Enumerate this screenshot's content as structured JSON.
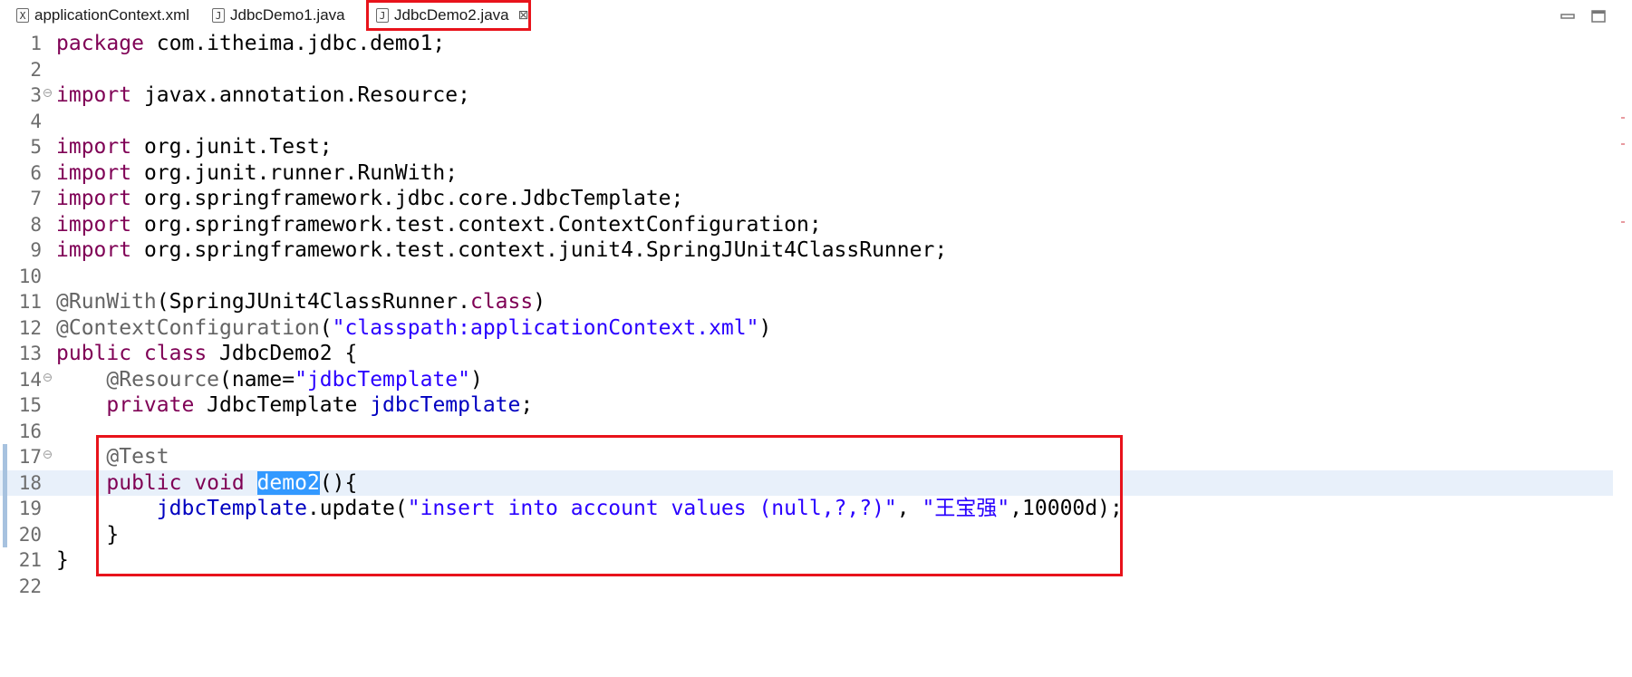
{
  "tabs": [
    {
      "label": "applicationContext.xml",
      "icon": "xml-file-icon",
      "glyph": "X"
    },
    {
      "label": "JdbcDemo1.java",
      "icon": "java-file-icon",
      "glyph": "J"
    },
    {
      "label": "JdbcDemo2.java",
      "icon": "java-file-icon",
      "glyph": "J",
      "close": "⊠",
      "active": true
    }
  ],
  "window_controls": {
    "minimize": "▭",
    "maximize": "▭"
  },
  "code_lines": [
    {
      "num": "1",
      "parts": [
        {
          "t": "kw",
          "v": "package"
        },
        {
          "t": "",
          "v": " com.itheima.jdbc.demo1;"
        }
      ]
    },
    {
      "num": "2",
      "parts": []
    },
    {
      "num": "3",
      "fold": "⊖",
      "parts": [
        {
          "t": "kw",
          "v": "import"
        },
        {
          "t": "",
          "v": " javax.annotation.Resource;"
        }
      ]
    },
    {
      "num": "4",
      "parts": []
    },
    {
      "num": "5",
      "parts": [
        {
          "t": "kw",
          "v": "import"
        },
        {
          "t": "",
          "v": " org.junit.Test;"
        }
      ]
    },
    {
      "num": "6",
      "parts": [
        {
          "t": "kw",
          "v": "import"
        },
        {
          "t": "",
          "v": " org.junit.runner.RunWith;"
        }
      ]
    },
    {
      "num": "7",
      "parts": [
        {
          "t": "kw",
          "v": "import"
        },
        {
          "t": "",
          "v": " org.springframework.jdbc.core.JdbcTemplate;"
        }
      ]
    },
    {
      "num": "8",
      "parts": [
        {
          "t": "kw",
          "v": "import"
        },
        {
          "t": "",
          "v": " org.springframework.test.context.ContextConfiguration;"
        }
      ]
    },
    {
      "num": "9",
      "parts": [
        {
          "t": "kw",
          "v": "import"
        },
        {
          "t": "",
          "v": " org.springframework.test.context.junit4.SpringJUnit4ClassRunner;"
        }
      ]
    },
    {
      "num": "10",
      "parts": []
    },
    {
      "num": "11",
      "parts": [
        {
          "t": "ann",
          "v": "@RunWith"
        },
        {
          "t": "",
          "v": "(SpringJUnit4ClassRunner."
        },
        {
          "t": "kw",
          "v": "class"
        },
        {
          "t": "",
          "v": ")"
        }
      ]
    },
    {
      "num": "12",
      "parts": [
        {
          "t": "ann",
          "v": "@ContextConfiguration"
        },
        {
          "t": "",
          "v": "("
        },
        {
          "t": "str",
          "v": "\"classpath:applicationContext.xml\""
        },
        {
          "t": "",
          "v": ")"
        }
      ]
    },
    {
      "num": "13",
      "parts": [
        {
          "t": "kw",
          "v": "public class"
        },
        {
          "t": "",
          "v": " JdbcDemo2 {"
        }
      ]
    },
    {
      "num": "14",
      "fold": "⊖",
      "parts": [
        {
          "t": "",
          "v": "    "
        },
        {
          "t": "ann",
          "v": "@Resource"
        },
        {
          "t": "",
          "v": "(name="
        },
        {
          "t": "str",
          "v": "\"jdbcTemplate\""
        },
        {
          "t": "",
          "v": ")"
        }
      ]
    },
    {
      "num": "15",
      "parts": [
        {
          "t": "",
          "v": "    "
        },
        {
          "t": "kw",
          "v": "private"
        },
        {
          "t": "",
          "v": " JdbcTemplate "
        },
        {
          "t": "fld",
          "v": "jdbcTemplate"
        },
        {
          "t": "",
          "v": ";"
        }
      ]
    },
    {
      "num": "16",
      "parts": []
    },
    {
      "num": "17",
      "fold": "⊖",
      "parts": [
        {
          "t": "",
          "v": "    "
        },
        {
          "t": "ann",
          "v": "@Test"
        }
      ]
    },
    {
      "num": "18",
      "current": true,
      "parts": [
        {
          "t": "",
          "v": "    "
        },
        {
          "t": "kw",
          "v": "public void"
        },
        {
          "t": "",
          "v": " "
        },
        {
          "t": "sel",
          "v": "demo2"
        },
        {
          "t": "",
          "v": "(){"
        }
      ]
    },
    {
      "num": "19",
      "parts": [
        {
          "t": "",
          "v": "        "
        },
        {
          "t": "fld",
          "v": "jdbcTemplate"
        },
        {
          "t": "",
          "v": ".update("
        },
        {
          "t": "str",
          "v": "\"insert into account values (null,?,?)\""
        },
        {
          "t": "",
          "v": ", "
        },
        {
          "t": "str",
          "v": "\"王宝强\""
        },
        {
          "t": "",
          "v": ",10000d);"
        }
      ]
    },
    {
      "num": "20",
      "parts": [
        {
          "t": "",
          "v": "    }"
        }
      ]
    },
    {
      "num": "21",
      "parts": [
        {
          "t": "",
          "v": "}"
        }
      ]
    },
    {
      "num": "22",
      "parts": []
    }
  ],
  "colors": {
    "keyword": "#7f0055",
    "string": "#2a00ff",
    "annotation": "#646464",
    "field": "#0000c0",
    "highlight_box": "#e8131b",
    "selection": "#3399ff"
  }
}
